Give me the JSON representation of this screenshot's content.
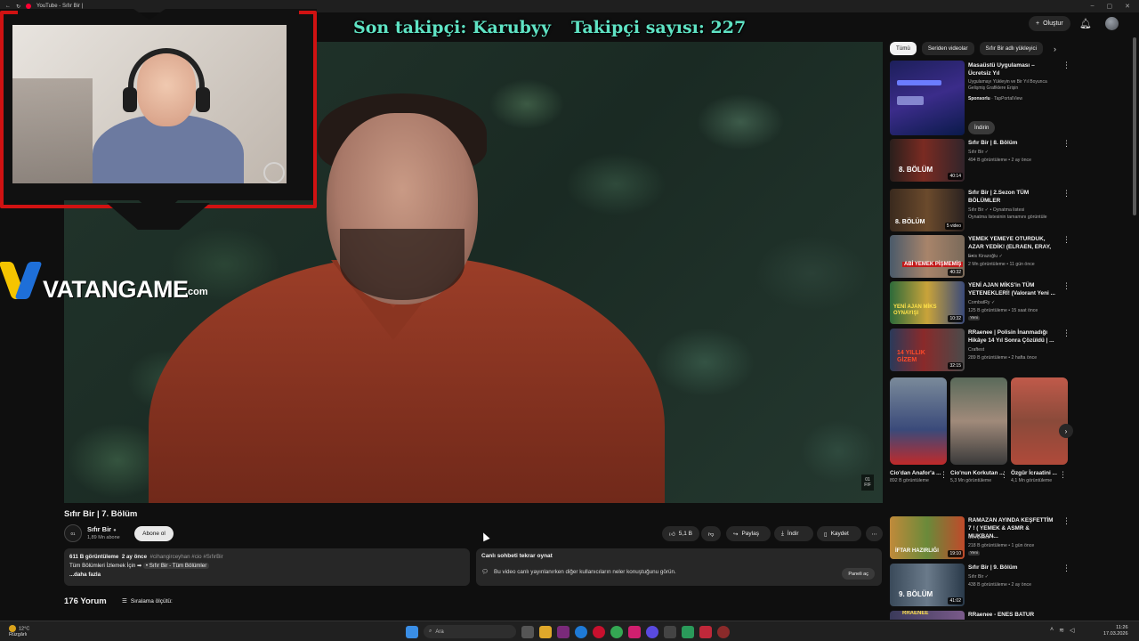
{
  "browser": {
    "tab_title": "YouTube - Sıfır Bir |",
    "window_controls": [
      "–",
      "▢",
      "✕"
    ]
  },
  "header": {
    "create_label": "Oluştur"
  },
  "overlay": {
    "last_follower": "Son takipçi: Karubyy",
    "follower_count": "Takipçi sayısı: 227",
    "brand_main": "VATANGAME",
    "brand_suffix": ".com"
  },
  "video": {
    "badge_top": "01",
    "badge_bottom": "FIF",
    "title": "Sıfır Bir | 7. Bölüm",
    "channel": {
      "avatar_text": "01",
      "name": "Sıfır Bir",
      "subscribers": "1,89 Mn abone",
      "subscribe_label": "Abone ol"
    },
    "actions": {
      "likes": "5,1 B",
      "share": "Paylaş",
      "download": "İndir",
      "save": "Kaydet"
    },
    "description": {
      "views": "611 B görüntüleme",
      "age": "2 ay önce",
      "tags": "#cihangirceyhan #cio #SıfırBir",
      "line2_prefix": "Tüm Bölümleri İzlemek İçin ➡",
      "line2_link": "• Sıfır Bir - Tüm Bölümler",
      "more": "...daha fazla"
    },
    "live_chat": {
      "title": "Canlı sohbeti tekrar oynat",
      "text": "Bu video canlı yayınlanırken diğer kullanıcıların neler konuştuğunu görün.",
      "open_label": "Paneli aç"
    },
    "comments": {
      "count": "176 Yorum",
      "sort_label": "Sıralama ölçütü:"
    }
  },
  "sidebar": {
    "chips": [
      "Tümü",
      "Seriden videolar",
      "Sıfır Bir adlı yükleyici"
    ],
    "ad": {
      "title": "Masaüstü Uygulaması – Ücretsiz Yıl",
      "desc": "Uygulamayı Yükleyin ve Bir Yıl Boyunca Gelişmiş Grafiklere Erişin",
      "sponsored": "Sponsorlu",
      "advertiser": "· TapPortalView",
      "install_label": "İndirin"
    },
    "recs": [
      {
        "title": "Sıfır Bir | 8. Bölüm",
        "channel": "Sıfır Bir ✓",
        "meta": "494 B görüntüleme • 2 ay önce",
        "duration": "40:14",
        "thumb_text": "8. BÖLÜM"
      },
      {
        "title": "Sıfır Bir | 2.Sezon TÜM BÖLÜMLER",
        "channel": "Sıfır Bir ✓ • Oynatma listesi",
        "meta": "Oynatma listesinin tamamını görüntüle",
        "duration": "5 video",
        "thumb_text": "8. BÖLÜM"
      },
      {
        "title": "YEMEK YEMEYE OTURDUK, AZAR YEDİK! (ELRAEN, ERAY, ...",
        "channel": "Enis Kirazoğlu ✓",
        "meta": "2 Mn görüntüleme • 11 gün önce",
        "duration": "40:32",
        "thumb_text": "ABİ YEMEK PİŞMEMİŞ"
      },
      {
        "title": "YENİ AJAN MİKS'in TÜM YETENEKLERİ! (Valorant Yeni ...",
        "channel": "CombatRy ✓",
        "meta": "125 B görüntüleme • 15 saat önce",
        "badge": "Yeni",
        "duration": "10:32",
        "thumb_text": "YENİ AJAN MİKS OYNAYIŞI"
      },
      {
        "title": "RRaenee | Polisin İnanmadığı Hikâye 14 Yıl Sonra Çözüldü | ...",
        "channel": "Craftest",
        "meta": "289 B görüntüleme • 2 hafta önce",
        "duration": "32:15",
        "thumb_text": "14 YILLIK GİZEM"
      }
    ],
    "shorts": [
      {
        "title": "Cio'dan Anafor'a ...",
        "views": "892 B görüntüleme"
      },
      {
        "title": "Cio'nun Korkutan ...",
        "views": "5,3 Mn görüntüleme"
      },
      {
        "title": "Özgür İcraatini ...",
        "views": "4,1 Mn görüntüleme"
      }
    ],
    "recs2": [
      {
        "title": "RAMAZAN AYINDA KEŞFETTİM 7 ! ( YEMEK & ASMR & MUKBAN...",
        "channel": "Sempatico ✓",
        "meta": "218 B görüntüleme • 1 gün önce",
        "badge": "Yeni",
        "duration": "19:10",
        "thumb_text": "İFTAR HAZIRLIĞI"
      },
      {
        "title": "Sıfır Bir | 9. Bölüm",
        "channel": "Sıfır Bir ✓",
        "meta": "438 B görüntüleme • 2 ay önce",
        "duration": "41:02",
        "thumb_text": "9. BÖLÜM"
      },
      {
        "title": "RRaenee - ENES BATUR",
        "channel": "",
        "meta": "",
        "duration": "",
        "thumb_text": "RRAENEE"
      }
    ]
  },
  "taskbar": {
    "weather_temp": "12°C",
    "weather_desc": "Rüzgârlı",
    "search_placeholder": "Ara",
    "time": "11:26",
    "date": "17.03.2026"
  },
  "colors": {
    "overlay_text": "#5fe3c4",
    "webcam_frame": "#d01212",
    "brand_yellow": "#f5c400",
    "brand_blue": "#1e6fd8"
  }
}
